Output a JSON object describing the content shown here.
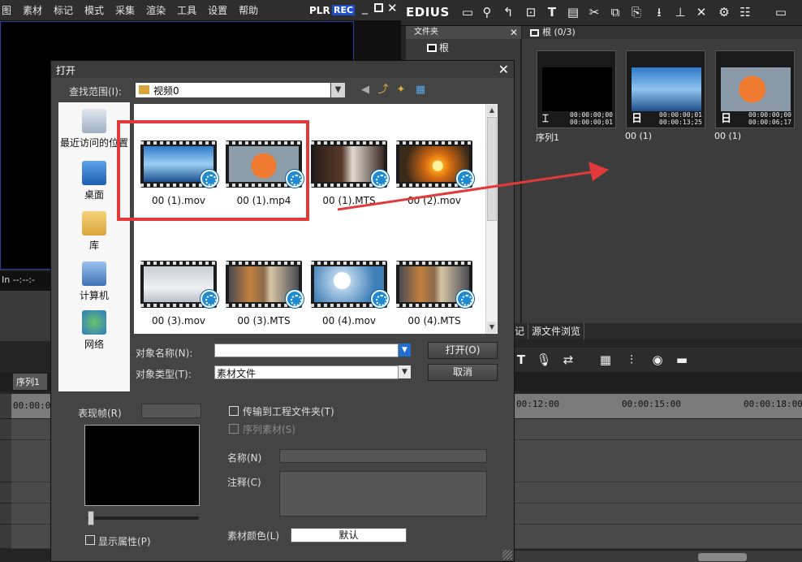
{
  "menu": [
    "图",
    "素材",
    "标记",
    "模式",
    "采集",
    "渲染",
    "工具",
    "设置",
    "帮助"
  ],
  "player": {
    "plr": "PLR",
    "rec": "REC",
    "inout": "In --:--:-"
  },
  "edius": {
    "logo": "EDIUS"
  },
  "folder_pane": {
    "title": "文件夹",
    "root": "根"
  },
  "bin": {
    "title": "根 (0/3)",
    "clips": [
      {
        "label": "序列1",
        "tc": [
          "00:00:00;00",
          "00:00:00;01"
        ],
        "icon": "sequence-icon"
      },
      {
        "label": "00 (1)",
        "tc": [
          "00:00:00;01",
          "00:00:13;25"
        ],
        "icon": "clip-icon"
      },
      {
        "label": "00 (1)",
        "tc": [
          "00:00:00;00",
          "00:00:06;17"
        ],
        "icon": "clip-icon"
      }
    ],
    "tabs": [
      "记",
      "源文件浏览"
    ]
  },
  "timeline": {
    "sequence_tab": "序列1",
    "ruler_left": "00:00:0",
    "ticks": [
      "00:12:00",
      "00:00:15:00",
      "00:00:18:00"
    ]
  },
  "dialog": {
    "title": "打开",
    "look_in_label": "查找范围(I):",
    "look_in_value": "视频0",
    "places": [
      "最近访问的位置",
      "桌面",
      "库",
      "计算机",
      "网络"
    ],
    "files": [
      {
        "name": "00 (1).mov",
        "thumb": "sky"
      },
      {
        "name": "00 (1).mp4",
        "thumb": "apple"
      },
      {
        "name": "00 (1).MTS",
        "thumb": "hand"
      },
      {
        "name": "00 (2).mov",
        "thumb": "sunset"
      },
      {
        "name": "00 (3).mov",
        "thumb": "snow"
      },
      {
        "name": "00 (3).MTS",
        "thumb": "stilllife"
      },
      {
        "name": "00 (4).mov",
        "thumb": "clouds"
      },
      {
        "name": "00 (4).MTS",
        "thumb": "stilllife"
      }
    ],
    "filename_label": "对象名称(N):",
    "filename_value": "",
    "filetype_label": "对象类型(T):",
    "filetype_value": "素材文件",
    "open_button": "打开(O)",
    "cancel_button": "取消",
    "preview_label": "表现帧(R)",
    "transfer_label": "传输到工程文件夹(T)",
    "sequence_label": "序列素材(S)",
    "name_label": "名称(N)",
    "comment_label": "注释(C)",
    "show_props_label": "显示属性(P)",
    "color_label": "素材颜色(L)",
    "color_value": "默认"
  },
  "colors": {
    "highlight": "#e23a3a",
    "accent_blue": "#1e4fc9"
  }
}
